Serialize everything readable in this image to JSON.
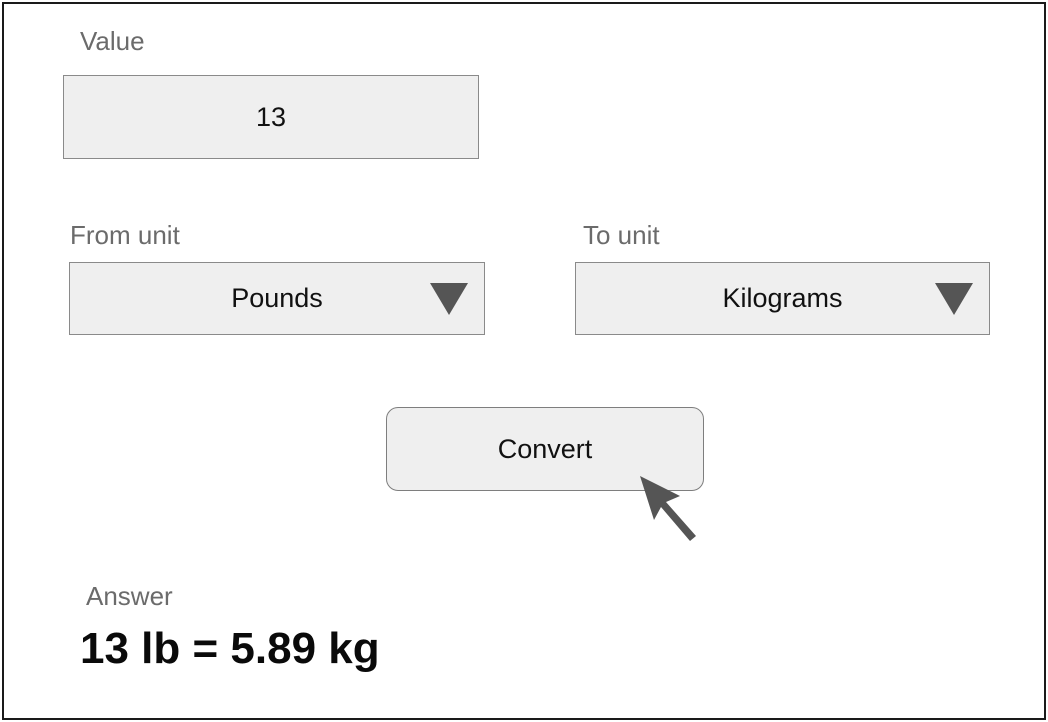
{
  "value_section": {
    "label": "Value",
    "input_value": "13"
  },
  "from_section": {
    "label": "From unit",
    "selected": "Pounds",
    "arrow_icon": "triangle-down-icon"
  },
  "to_section": {
    "label": "To unit",
    "selected": "Kilograms",
    "arrow_icon": "triangle-down-icon"
  },
  "convert_button": {
    "label": "Convert"
  },
  "cursor": {
    "icon": "arrow-cursor-icon"
  },
  "answer_section": {
    "label": "Answer",
    "result": "13 lb = 5.89 kg"
  },
  "colors": {
    "field_background": "#efefef",
    "label_text": "#6b6b6b",
    "border": "#8a8a8a",
    "icon": "#555555"
  }
}
